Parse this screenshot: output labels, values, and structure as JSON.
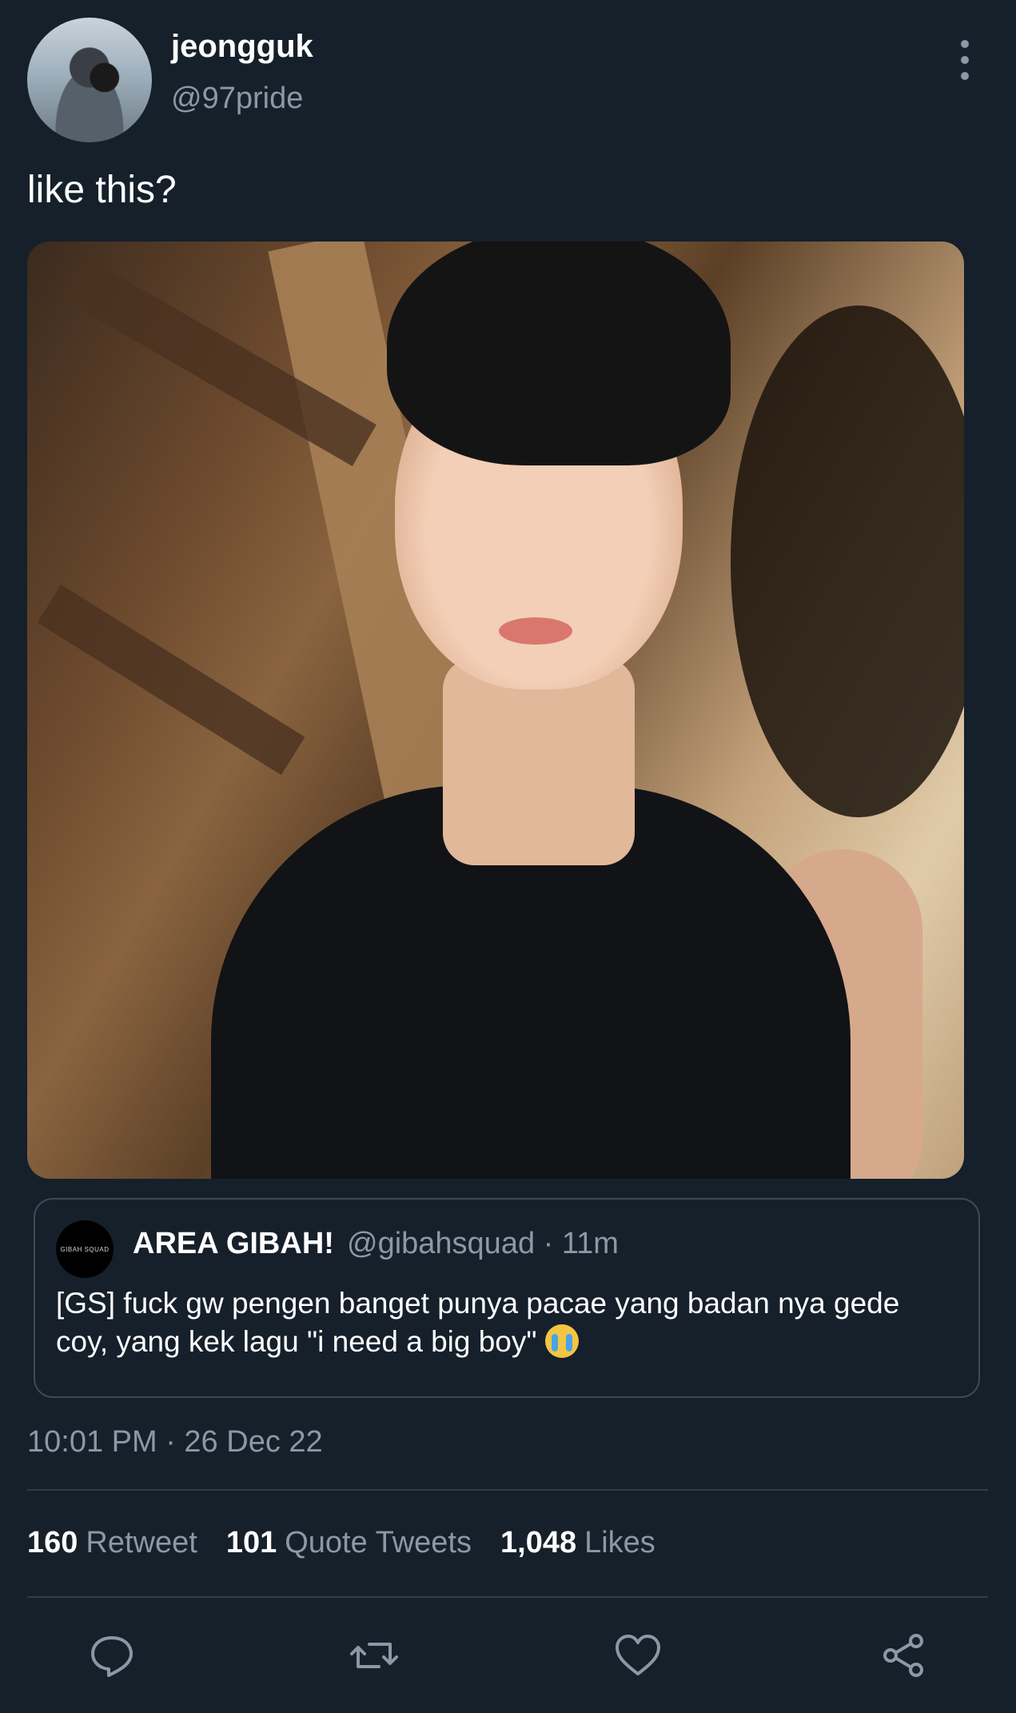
{
  "author": {
    "name": "jeongguk",
    "handle": "@97pride"
  },
  "tweet": {
    "text": "like this?"
  },
  "quoted": {
    "avatar_text": "GIBAH SQUAD",
    "name": "AREA GIBAH!",
    "handle_time": "@gibahsquad · 11m",
    "text": "[GS] fuck gw pengen banget punya pacae yang badan nya gede coy, yang kek lagu \"i need a big boy\"",
    "emoji": "loudly-crying-face"
  },
  "timestamp": "10:01 PM · 26 Dec 22",
  "stats": {
    "retweets_count": "160",
    "retweets_label": "Retweet",
    "quotes_count": "101",
    "quotes_label": "Quote Tweets",
    "likes_count": "1,048",
    "likes_label": "Likes"
  },
  "icons": {
    "reply": "reply-icon",
    "retweet": "retweet-icon",
    "like": "heart-icon",
    "share": "share-icon",
    "more": "more-vertical-icon"
  },
  "colors": {
    "background": "#15202b",
    "secondary_text": "#8b98a5",
    "divider": "#2f3d4a"
  }
}
